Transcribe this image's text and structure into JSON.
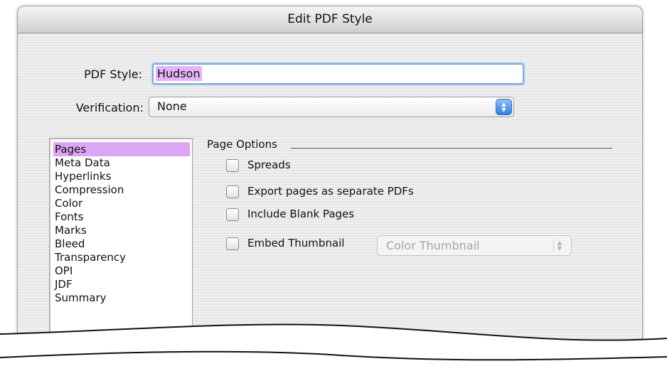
{
  "window": {
    "title": "Edit PDF Style"
  },
  "form": {
    "pdf_style_label": "PDF Style:",
    "pdf_style_value": "Hudson",
    "verification_label": "Verification:",
    "verification_value": "None"
  },
  "categories": [
    {
      "label": "Pages",
      "selected": true
    },
    {
      "label": "Meta Data"
    },
    {
      "label": "Hyperlinks"
    },
    {
      "label": "Compression"
    },
    {
      "label": "Color"
    },
    {
      "label": "Fonts"
    },
    {
      "label": "Marks"
    },
    {
      "label": "Bleed"
    },
    {
      "label": "Transparency"
    },
    {
      "label": "OPI"
    },
    {
      "label": "JDF"
    },
    {
      "label": "Summary"
    }
  ],
  "page_options": {
    "heading": "Page Options",
    "options": [
      {
        "label": "Spreads",
        "checked": false
      },
      {
        "label": "Export pages as separate PDFs",
        "checked": false
      },
      {
        "label": "Include Blank Pages",
        "checked": false
      },
      {
        "label": "Embed Thumbnail",
        "checked": false
      }
    ],
    "thumbnail_select_value": "Color Thumbnail",
    "thumbnail_select_enabled": false
  },
  "colors": {
    "selection_highlight": "#dda6f5",
    "focus_ring": "#77a7e3",
    "popup_stepper": "#2e7de6"
  }
}
